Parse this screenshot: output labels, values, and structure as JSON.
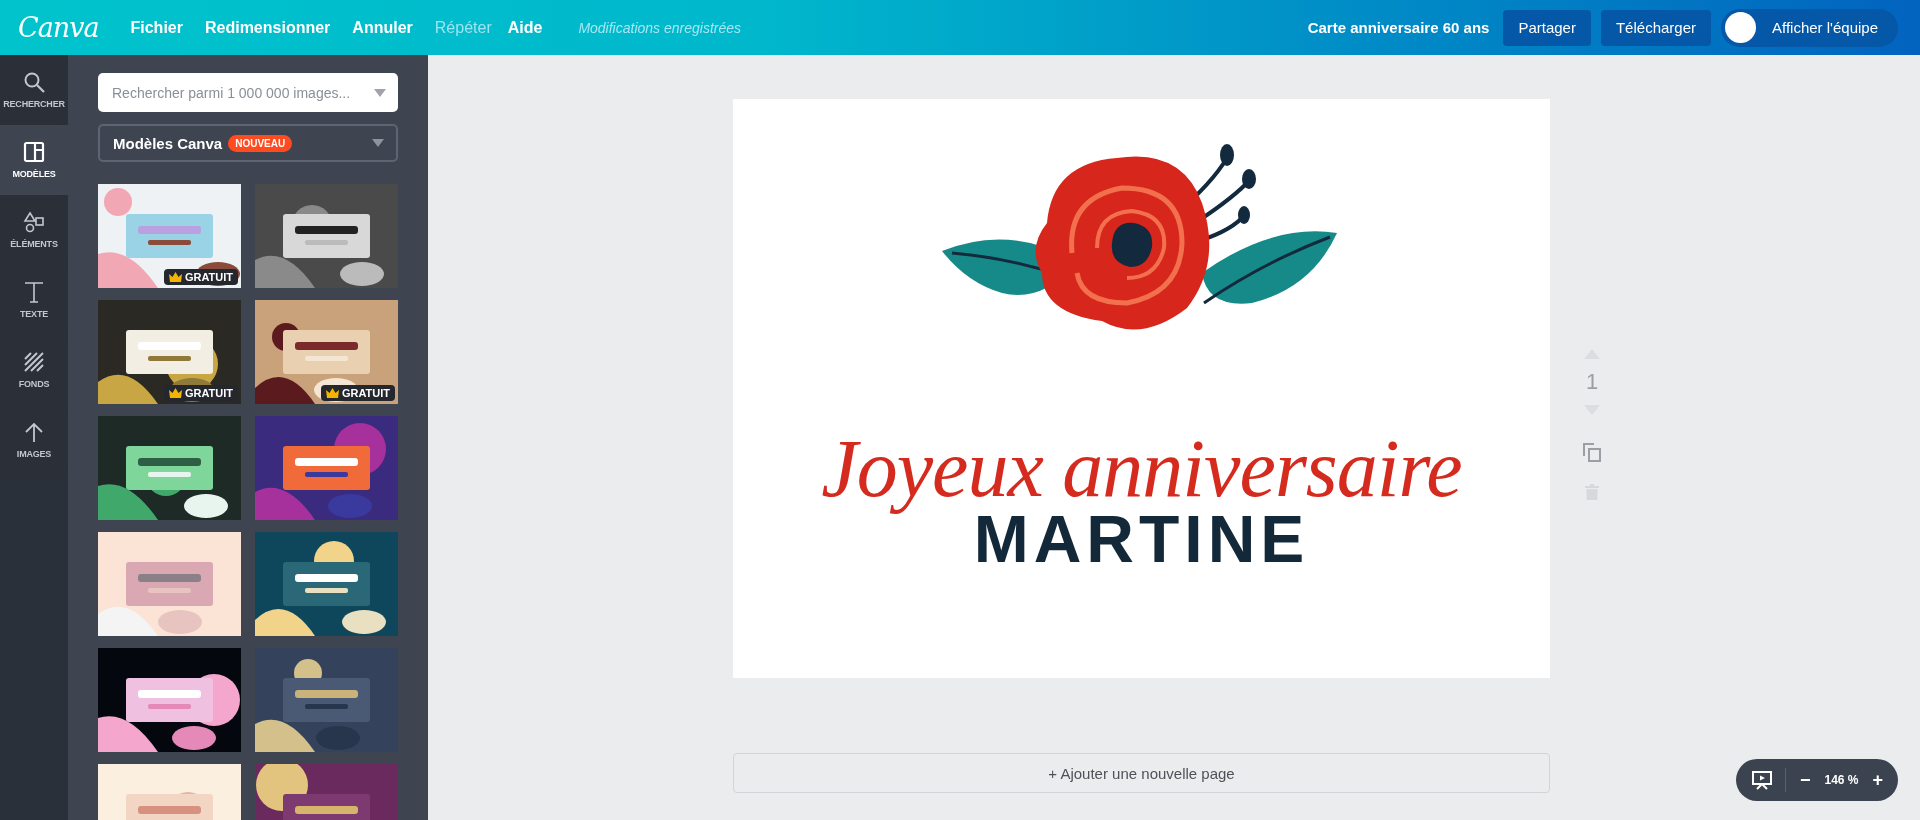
{
  "topbar": {
    "logo": "Canva",
    "menu": [
      {
        "label": "Fichier",
        "disabled": false
      },
      {
        "label": "Redimensionner",
        "disabled": false
      },
      {
        "label": "Annuler",
        "disabled": false
      },
      {
        "label": "Répéter",
        "disabled": true
      },
      {
        "label": "Aide",
        "disabled": false
      }
    ],
    "save_status": "Modifications enregistrées",
    "document_title": "Carte anniversaire 60 ans",
    "buttons": [
      "Partager",
      "Télécharger"
    ],
    "team_button": "Afficher l'équipe"
  },
  "rail": [
    {
      "kind": "search",
      "label": "RECHERCHER",
      "selected": false
    },
    {
      "kind": "templates",
      "label": "MODÈLES",
      "selected": true
    },
    {
      "kind": "elements",
      "label": "ÉLÉMENTS",
      "selected": false
    },
    {
      "kind": "text",
      "label": "TEXTE",
      "selected": false
    },
    {
      "kind": "backgrounds",
      "label": "FONDS",
      "selected": false
    },
    {
      "kind": "uploads",
      "label": "IMAGES",
      "selected": false
    }
  ],
  "panel": {
    "search": {
      "placeholder": "Rechercher parmi 1 000 000 images..."
    },
    "category": {
      "label": "Modèles Canva",
      "badge": "NOUVEAU"
    },
    "templates": [
      {
        "kind": "picture",
        "badge": "GRATUIT"
      },
      {
        "kind": "picture"
      },
      {
        "kind": "picture",
        "badge": "GRATUIT"
      },
      {
        "kind": "picture",
        "badge": "GRATUIT"
      },
      {
        "kind": "picture"
      },
      {
        "kind": "picture"
      },
      {
        "kind": "picture"
      },
      {
        "kind": "picture"
      },
      {
        "kind": "picture"
      },
      {
        "kind": "picture"
      },
      {
        "kind": "picture"
      },
      {
        "kind": "picture"
      }
    ]
  },
  "canvas": {
    "greeting": "Joyeux anniversaire",
    "name": "MARTINE",
    "page_number": "1",
    "add_page": "+ Ajouter une nouvelle page"
  },
  "zoom": {
    "minus": "−",
    "value": "146 %",
    "plus": "+"
  }
}
